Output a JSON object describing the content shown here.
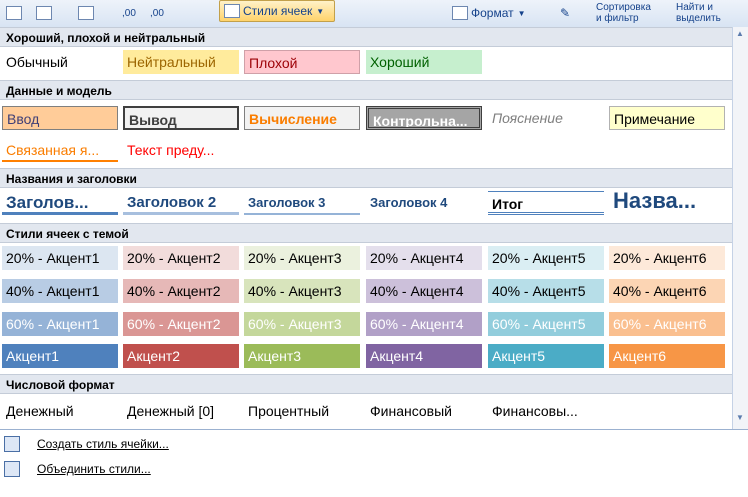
{
  "ribbon": {
    "styles_label": "Стили ячеек",
    "format_label": "Формат",
    "sort_line1": "Сортировка",
    "sort_line2": "и фильтр",
    "find_line1": "Найти и",
    "find_line2": "выделить",
    "num_left": ",00",
    "num_right": ",00"
  },
  "sections": {
    "s1": "Хороший, плохой и нейтральный",
    "s2": "Данные и модель",
    "s3": "Названия и заголовки",
    "s4": "Стили ячеек с темой",
    "s5": "Числовой формат"
  },
  "good_bad": [
    "Обычный",
    "Нейтральный",
    "Плохой",
    "Хороший"
  ],
  "data_model": [
    "Ввод",
    "Вывод",
    "Вычисление",
    "Контрольна...",
    "Пояснение",
    "Примечание",
    "Связанная я...",
    "Текст преду..."
  ],
  "titles": [
    "Заголов...",
    "Заголовок 2",
    "Заголовок 3",
    "Заголовок 4",
    "Итог",
    "Назва..."
  ],
  "theme20": [
    "20% - Акцент1",
    "20% - Акцент2",
    "20% - Акцент3",
    "20% - Акцент4",
    "20% - Акцент5",
    "20% - Акцент6"
  ],
  "theme40": [
    "40% - Акцент1",
    "40% - Акцент2",
    "40% - Акцент3",
    "40% - Акцент4",
    "40% - Акцент5",
    "40% - Акцент6"
  ],
  "theme60": [
    "60% - Акцент1",
    "60% - Акцент2",
    "60% - Акцент3",
    "60% - Акцент4",
    "60% - Акцент5",
    "60% - Акцент6"
  ],
  "accent": [
    "Акцент1",
    "Акцент2",
    "Акцент3",
    "Акцент4",
    "Акцент5",
    "Акцент6"
  ],
  "number": [
    "Денежный",
    "Денежный [0]",
    "Процентный",
    "Финансовый",
    "Финансовы..."
  ],
  "footer": {
    "create": "Создать стиль ячейки...",
    "merge": "Объединить стили..."
  },
  "colors": {
    "accent": [
      "#4f81bd",
      "#c0504d",
      "#9bbb59",
      "#8064a2",
      "#4bacc6",
      "#f79646"
    ],
    "tint20": [
      "#dce6f1",
      "#f2dcdb",
      "#ebf1de",
      "#e4dfec",
      "#daeef3",
      "#fde9d9"
    ],
    "tint40": [
      "#b8cce4",
      "#e6b8b7",
      "#d8e4bc",
      "#ccc0da",
      "#b7dee8",
      "#fcd5b4"
    ],
    "tint60": [
      "#95b3d7",
      "#da9694",
      "#c4d79b",
      "#b1a0c7",
      "#92cddc",
      "#fabf8f"
    ]
  }
}
